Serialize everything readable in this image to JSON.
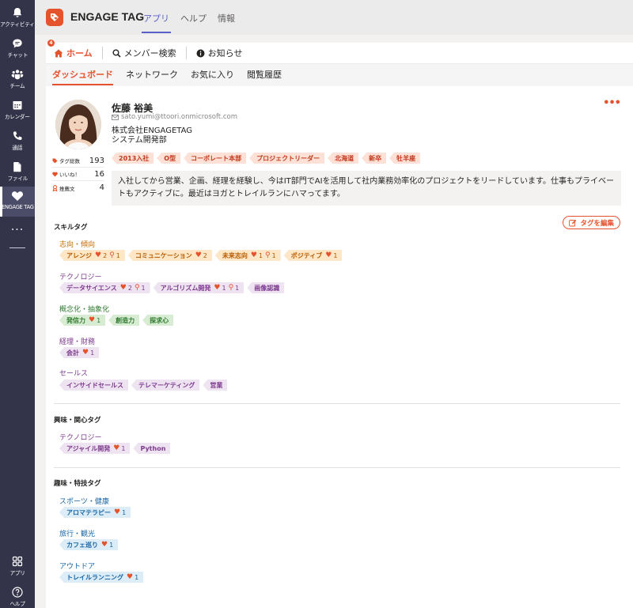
{
  "rail": [
    {
      "label": "アクティビティ",
      "icon": "bell-icon"
    },
    {
      "label": "チャット",
      "icon": "chat-icon"
    },
    {
      "label": "チーム",
      "icon": "teams-icon"
    },
    {
      "label": "カレンダー",
      "icon": "calendar-icon"
    },
    {
      "label": "通話",
      "icon": "phone-icon"
    },
    {
      "label": "ファイル",
      "icon": "file-icon"
    },
    {
      "label": "ENGAGE TAG",
      "icon": "engage-tag-icon"
    },
    {
      "label": "アプリ",
      "icon": "apps-icon"
    },
    {
      "label": "ヘルプ",
      "icon": "help-icon"
    }
  ],
  "app": {
    "title": "ENGAGE TAG",
    "tabs": [
      "アプリ",
      "ヘルプ",
      "情報"
    ]
  },
  "nav1": {
    "badge": "4",
    "items": [
      "ホーム",
      "メンバー検索",
      "お知らせ"
    ]
  },
  "nav2": [
    "ダッシュボード",
    "ネットワーク",
    "お気に入り",
    "閲覧履歴"
  ],
  "profile": {
    "name": "佐藤 裕美",
    "email": "sato.yumi@ttoori.onmicrosoft.com",
    "company": "株式会社ENGAGETAG",
    "department": "システム開発部",
    "stats": [
      {
        "label": "タグ総数",
        "value": "193"
      },
      {
        "label": "いいね！",
        "value": "16"
      },
      {
        "label": "推薦文",
        "value": "4"
      }
    ],
    "tags": [
      "2013入社",
      "O型",
      "コーポレート本部",
      "プロジェクトリーダー",
      "北海道",
      "新卒",
      "牡羊座"
    ],
    "bio": "入社してから営業、企画、経理を経験し、今はIT部門でAIを活用して社内業務効率化のプロジェクトをリードしています。仕事もプライベートもアクティブに。最近はヨガとトレイルランにハマってます。"
  },
  "skills": {
    "title": "スキルタグ",
    "edit_label": "タグを編集",
    "categories": [
      {
        "name": "志向・傾向",
        "tags": [
          {
            "label": "アレンジ",
            "likes": "2",
            "recs": "1"
          },
          {
            "label": "コミュニケーション",
            "likes": "2"
          },
          {
            "label": "未来志向",
            "likes": "1",
            "recs": "1"
          },
          {
            "label": "ポジティブ",
            "likes": "1"
          }
        ]
      },
      {
        "name": "テクノロジー",
        "tags": [
          {
            "label": "データサイエンス",
            "likes": "2",
            "recs": "1"
          },
          {
            "label": "アルゴリズム開発",
            "likes": "1",
            "recs": "1"
          },
          {
            "label": "画像認識"
          }
        ]
      },
      {
        "name": "概念化・抽象化",
        "tags": [
          {
            "label": "発信力",
            "likes": "1"
          },
          {
            "label": "創造力"
          },
          {
            "label": "探求心"
          }
        ]
      },
      {
        "name": "経理・財務",
        "tags": [
          {
            "label": "会計",
            "likes": "1"
          }
        ]
      },
      {
        "name": "セールス",
        "tags": [
          {
            "label": "インサイドセールス"
          },
          {
            "label": "テレマーケティング"
          },
          {
            "label": "営業"
          }
        ]
      }
    ]
  },
  "interests": {
    "title": "興味・関心タグ",
    "categories": [
      {
        "name": "テクノロジー",
        "tags": [
          {
            "label": "アジャイル開発",
            "likes": "1"
          },
          {
            "label": "Python"
          }
        ]
      }
    ]
  },
  "hobbies": {
    "title": "趣味・特技タグ",
    "categories": [
      {
        "name": "スポーツ・健康",
        "tags": [
          {
            "label": "アロマテラピー",
            "likes": "1"
          }
        ]
      },
      {
        "name": "旅行・観光",
        "tags": [
          {
            "label": "カフェ巡り",
            "likes": "1"
          }
        ]
      },
      {
        "name": "アウトドア",
        "tags": [
          {
            "label": "トレイルランニング",
            "likes": "1"
          }
        ]
      }
    ]
  },
  "colors": {
    "accent": "#e5532d",
    "rail": "#33344a",
    "teams_purple": "#5b5fc7"
  }
}
